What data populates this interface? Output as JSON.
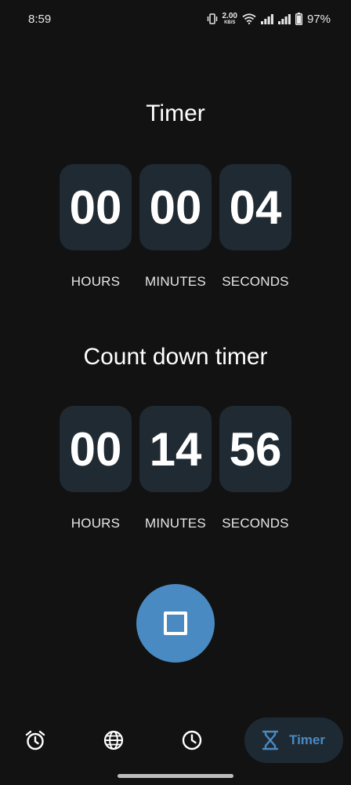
{
  "status_bar": {
    "time": "8:59",
    "net_speed_value": "2.00",
    "net_speed_unit": "KB/S",
    "battery_percent": "97%"
  },
  "timer": {
    "title": "Timer",
    "hours": "00",
    "minutes": "00",
    "seconds": "04",
    "labels": {
      "hours": "HOURS",
      "minutes": "MINUTES",
      "seconds": "SECONDS"
    }
  },
  "countdown": {
    "title": "Count down timer",
    "hours": "00",
    "minutes": "14",
    "seconds": "56",
    "labels": {
      "hours": "HOURS",
      "minutes": "MINUTES",
      "seconds": "SECONDS"
    }
  },
  "controls": {
    "stop_icon": "stop-icon"
  },
  "bottom_nav": {
    "items": [
      {
        "icon": "alarm-clock-icon"
      },
      {
        "icon": "globe-icon"
      },
      {
        "icon": "clock-icon"
      },
      {
        "icon": "hourglass-icon",
        "label": "Timer",
        "selected": true
      }
    ]
  },
  "colors": {
    "background": "#121212",
    "digit_box": "#1f2a33",
    "accent": "#4a8ac3",
    "nav_selected_bg": "#1e2a33"
  }
}
